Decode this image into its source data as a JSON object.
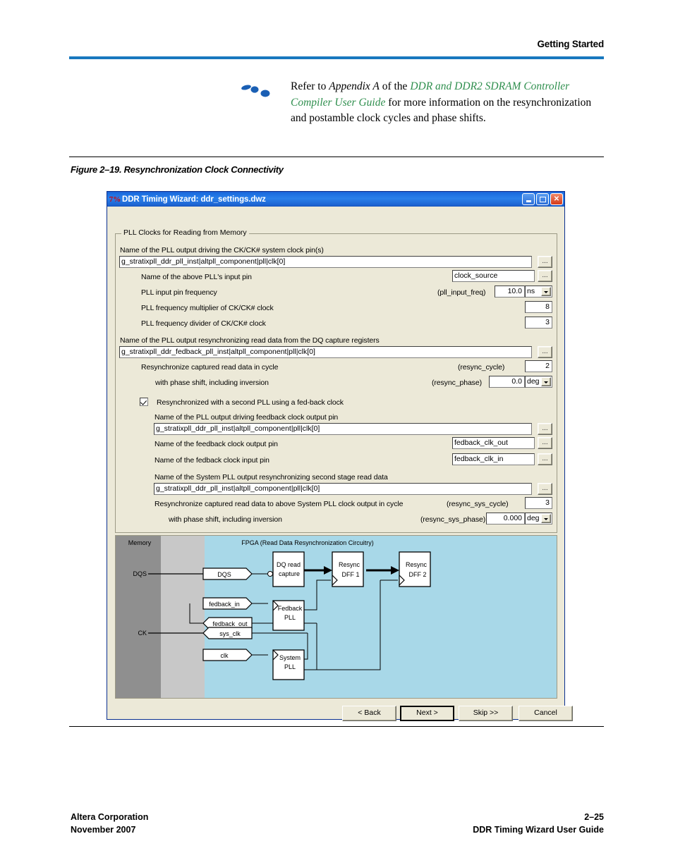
{
  "page": {
    "header_title": "Getting Started",
    "figure_caption": "Figure 2–19. Resynchronization Clock Connectivity",
    "note": {
      "prefix": "Refer to ",
      "em1": "Appendix A",
      "mid": " of the ",
      "link": "DDR and DDR2 SDRAM Controller Compiler User Guide",
      "suffix": " for more information on the resynchronization and postamble clock cycles and phase shifts."
    },
    "footer": {
      "company": "Altera Corporation",
      "date": "November 2007",
      "page_number": "2–25",
      "doc_title": "DDR Timing Wizard User Guide"
    },
    "accent_color": "#1878be",
    "link_color": "#2f8f4e"
  },
  "dialog": {
    "title": "DDR Timing Wizard: ddr_settings.dwz",
    "title_icon": "wizard-icon",
    "window_buttons": {
      "minimize": "minimize-icon",
      "maximize": "maximize-icon",
      "close": "✕"
    },
    "group_title": "PLL Clocks for Reading from Memory",
    "browse_label": "...",
    "rows": {
      "pll_output_ck_label": "Name of the PLL output driving the CK/CK# system clock pin(s)",
      "pll_output_ck_value": "g_stratixpll_ddr_pll_inst|altpll_component|pll|clk[0]",
      "pll_input_pin_label": "Name of the above PLL's input pin",
      "pll_input_pin_value": "clock_source",
      "pll_input_freq_label": "PLL input pin frequency",
      "pll_input_freq_tag": "(pll_input_freq)",
      "pll_input_freq_value": "10.0",
      "pll_input_freq_unit": "ns",
      "pll_mult_label": "PLL frequency multiplier of CK/CK# clock",
      "pll_mult_value": "8",
      "pll_div_label": "PLL frequency divider of CK/CK# clock",
      "pll_div_value": "3",
      "pll_resync_output_label": "Name of the PLL output resynchronizing read data from the DQ capture registers",
      "pll_resync_output_value": "g_stratixpll_ddr_fedback_pll_inst|altpll_component|pll|clk[0]",
      "resync_cycle_label": "Resynchronize captured read data in cycle",
      "resync_cycle_tag": "(resync_cycle)",
      "resync_cycle_value": "2",
      "resync_phase_label": "with phase shift, including inversion",
      "resync_phase_tag": "(resync_phase)",
      "resync_phase_value": "0.0",
      "resync_phase_unit": "deg",
      "second_pll_checkbox_label": "Resynchronized with a second PLL using a fed-back clock",
      "second_pll_checked": true,
      "fb_out_pll_label": "Name of the PLL output driving feedback clock output pin",
      "fb_out_pll_value": "g_stratixpll_ddr_pll_inst|altpll_component|pll|clk[0]",
      "fb_clk_out_label": "Name of the feedback clock output pin",
      "fb_clk_out_value": "fedback_clk_out",
      "fb_clk_in_label": "Name of the fedback clock input pin",
      "fb_clk_in_value": "fedback_clk_in",
      "sys_pll_label": "Name of the System PLL output resynchronizing second stage read data",
      "sys_pll_value": "g_stratixpll_ddr_pll_inst|altpll_component|pll|clk[0]",
      "resync_sys_cycle_label": "Resynchronize captured read data to above System PLL clock output in cycle",
      "resync_sys_cycle_tag": "(resync_sys_cycle)",
      "resync_sys_cycle_value": "3",
      "resync_sys_phase_label": "with phase shift, including inversion",
      "resync_sys_phase_tag": "(resync_sys_phase)",
      "resync_sys_phase_value": "0.000",
      "resync_sys_phase_unit": "deg"
    },
    "diagram": {
      "memory_label": "Memory",
      "fpga_label": "FPGA (Read Data Resynchronization Circuitry)",
      "pin_dqs": "DQS",
      "pin_ck": "CK",
      "port_dqs": "DQS",
      "port_fedback_in": "fedback_in",
      "port_fedback_out": "fedback_out",
      "port_sys_clk": "sys_clk",
      "port_clk": "clk",
      "block_dq_read_line1": "DQ read",
      "block_dq_read_line2": "capture",
      "block_fedback_pll_line1": "Fedback",
      "block_fedback_pll_line2": "PLL",
      "block_system_pll_line1": "System",
      "block_system_pll_line2": "PLL",
      "block_resync1_line1": "Resync",
      "block_resync1_line2": "DFF 1",
      "block_resync2_line1": "Resync",
      "block_resync2_line2": "DFF 2",
      "memory_color": "#8f8f8f",
      "interface_color": "#c8c8c8",
      "fpga_color": "#a8d8e8"
    },
    "buttons": {
      "back": "< Back",
      "next": "Next >",
      "skip": "Skip >>",
      "cancel": "Cancel"
    }
  }
}
